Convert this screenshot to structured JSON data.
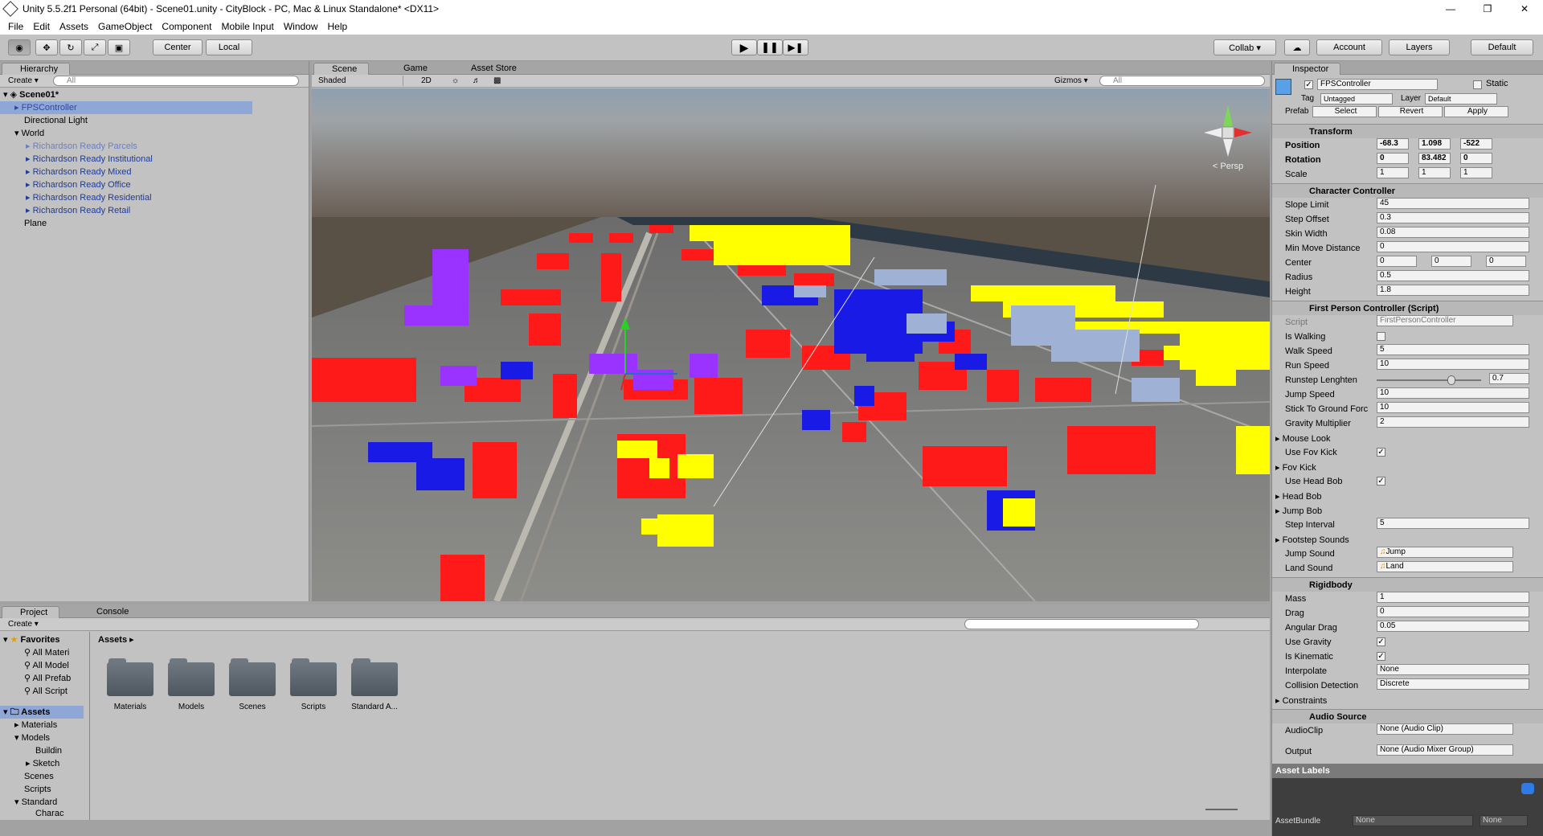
{
  "window": {
    "title": "Unity 5.5.2f1 Personal (64bit) - Scene01.unity - CityBlock - PC, Mac & Linux Standalone* <DX11>",
    "controls": [
      "—",
      "❐",
      "✕"
    ]
  },
  "menu": [
    "File",
    "Edit",
    "Assets",
    "GameObject",
    "Component",
    "Mobile Input",
    "Window",
    "Help"
  ],
  "toolbar": {
    "tools": [
      "view-icon",
      "move-icon",
      "rotate-icon",
      "scale-icon",
      "rect-icon"
    ],
    "center": "Center",
    "local": "Local",
    "collab": "Collab ▾",
    "account": "Account",
    "layers": "Layers",
    "layout": "Default"
  },
  "hierarchy": {
    "tab": "Hierarchy",
    "create": "Create ▾",
    "search": "All",
    "scene": "Scene01*",
    "items": [
      "FPSController",
      "Directional Light",
      "World",
      "Richardson Ready Parcels",
      "Richardson Ready Institutional",
      "Richardson Ready Mixed",
      "Richardson Ready Office",
      "Richardson Ready Residential",
      "Richardson Ready Retail",
      "Plane"
    ]
  },
  "scene": {
    "tabs": [
      "Scene",
      "Game",
      "Asset Store"
    ],
    "shading": "Shaded",
    "mode2d": "2D",
    "gizmos": "Gizmos ▾",
    "search": "All",
    "persp": "< Persp"
  },
  "project": {
    "tabs": [
      "Project",
      "Console"
    ],
    "create": "Create ▾",
    "favorites": "Favorites",
    "fav_items": [
      "All Materi",
      "All Model",
      "All Prefab",
      "All Script"
    ],
    "assets_label": "Assets",
    "tree": [
      "Materials",
      "Models",
      "Buildin",
      "Sketch",
      "Scenes",
      "Scripts",
      "Standard",
      "Charac"
    ],
    "breadcrumb": "Assets ▸",
    "folders": [
      "Materials",
      "Models",
      "Scenes",
      "Scripts",
      "Standard A..."
    ]
  },
  "inspector": {
    "tab": "Inspector",
    "name": "FPSController",
    "static": "Static",
    "tag_label": "Tag",
    "tag": "Untagged",
    "layer_label": "Layer",
    "layer": "Default",
    "prefab_label": "Prefab",
    "select": "Select",
    "revert": "Revert",
    "apply": "Apply",
    "transform": {
      "title": "Transform",
      "position_label": "Position",
      "pos": [
        "-68.3",
        "1.098",
        "-522"
      ],
      "rotation_label": "Rotation",
      "rot": [
        "0",
        "83.482",
        "0"
      ],
      "scale_label": "Scale",
      "scale": [
        "1",
        "1",
        "1"
      ]
    },
    "cc": {
      "title": "Character Controller",
      "rows": [
        [
          "Slope Limit",
          "45"
        ],
        [
          "Step Offset",
          "0.3"
        ],
        [
          "Skin Width",
          "0.08"
        ],
        [
          "Min Move Distance",
          "0"
        ]
      ],
      "center_label": "Center",
      "center": [
        "0",
        "0",
        "0"
      ],
      "radius_label": "Radius",
      "radius": "0.5",
      "height_label": "Height",
      "height": "1.8"
    },
    "fpc": {
      "title": "First Person Controller (Script)",
      "script_label": "Script",
      "script": "FirstPersonController",
      "is_walking": "Is Walking",
      "walk_label": "Walk Speed",
      "walk": "5",
      "run_label": "Run Speed",
      "run": "10",
      "runstep_label": "Runstep Lenghten",
      "runstep": "0.7",
      "jump_label": "Jump Speed",
      "jump": "10",
      "stick_label": "Stick To Ground Forc",
      "stick": "10",
      "grav_label": "Gravity Multiplier",
      "grav": "2",
      "mouse_look": "Mouse Look",
      "use_fov": "Use Fov Kick",
      "fov": "Fov Kick",
      "use_head": "Use Head Bob",
      "head": "Head Bob",
      "jump_bob": "Jump Bob",
      "step_label": "Step Interval",
      "step": "5",
      "footstep": "Footstep Sounds",
      "jump_sound_label": "Jump Sound",
      "jump_sound": "Jump",
      "land_sound_label": "Land Sound",
      "land_sound": "Land"
    },
    "rb": {
      "title": "Rigidbody",
      "mass_label": "Mass",
      "mass": "1",
      "drag_label": "Drag",
      "drag": "0",
      "ang_label": "Angular Drag",
      "ang": "0.05",
      "grav_label": "Use Gravity",
      "kin_label": "Is Kinematic",
      "interp_label": "Interpolate",
      "interp": "None",
      "coll_label": "Collision Detection",
      "coll": "Discrete",
      "constraints": "Constraints"
    },
    "audio": {
      "title": "Audio Source",
      "clip_label": "AudioClip",
      "clip": "None (Audio Clip)",
      "out_label": "Output",
      "out": "None (Audio Mixer Group)"
    },
    "asset_labels": "Asset Labels",
    "asset_bundle": "AssetBundle",
    "ab1": "None",
    "ab2": "None"
  }
}
